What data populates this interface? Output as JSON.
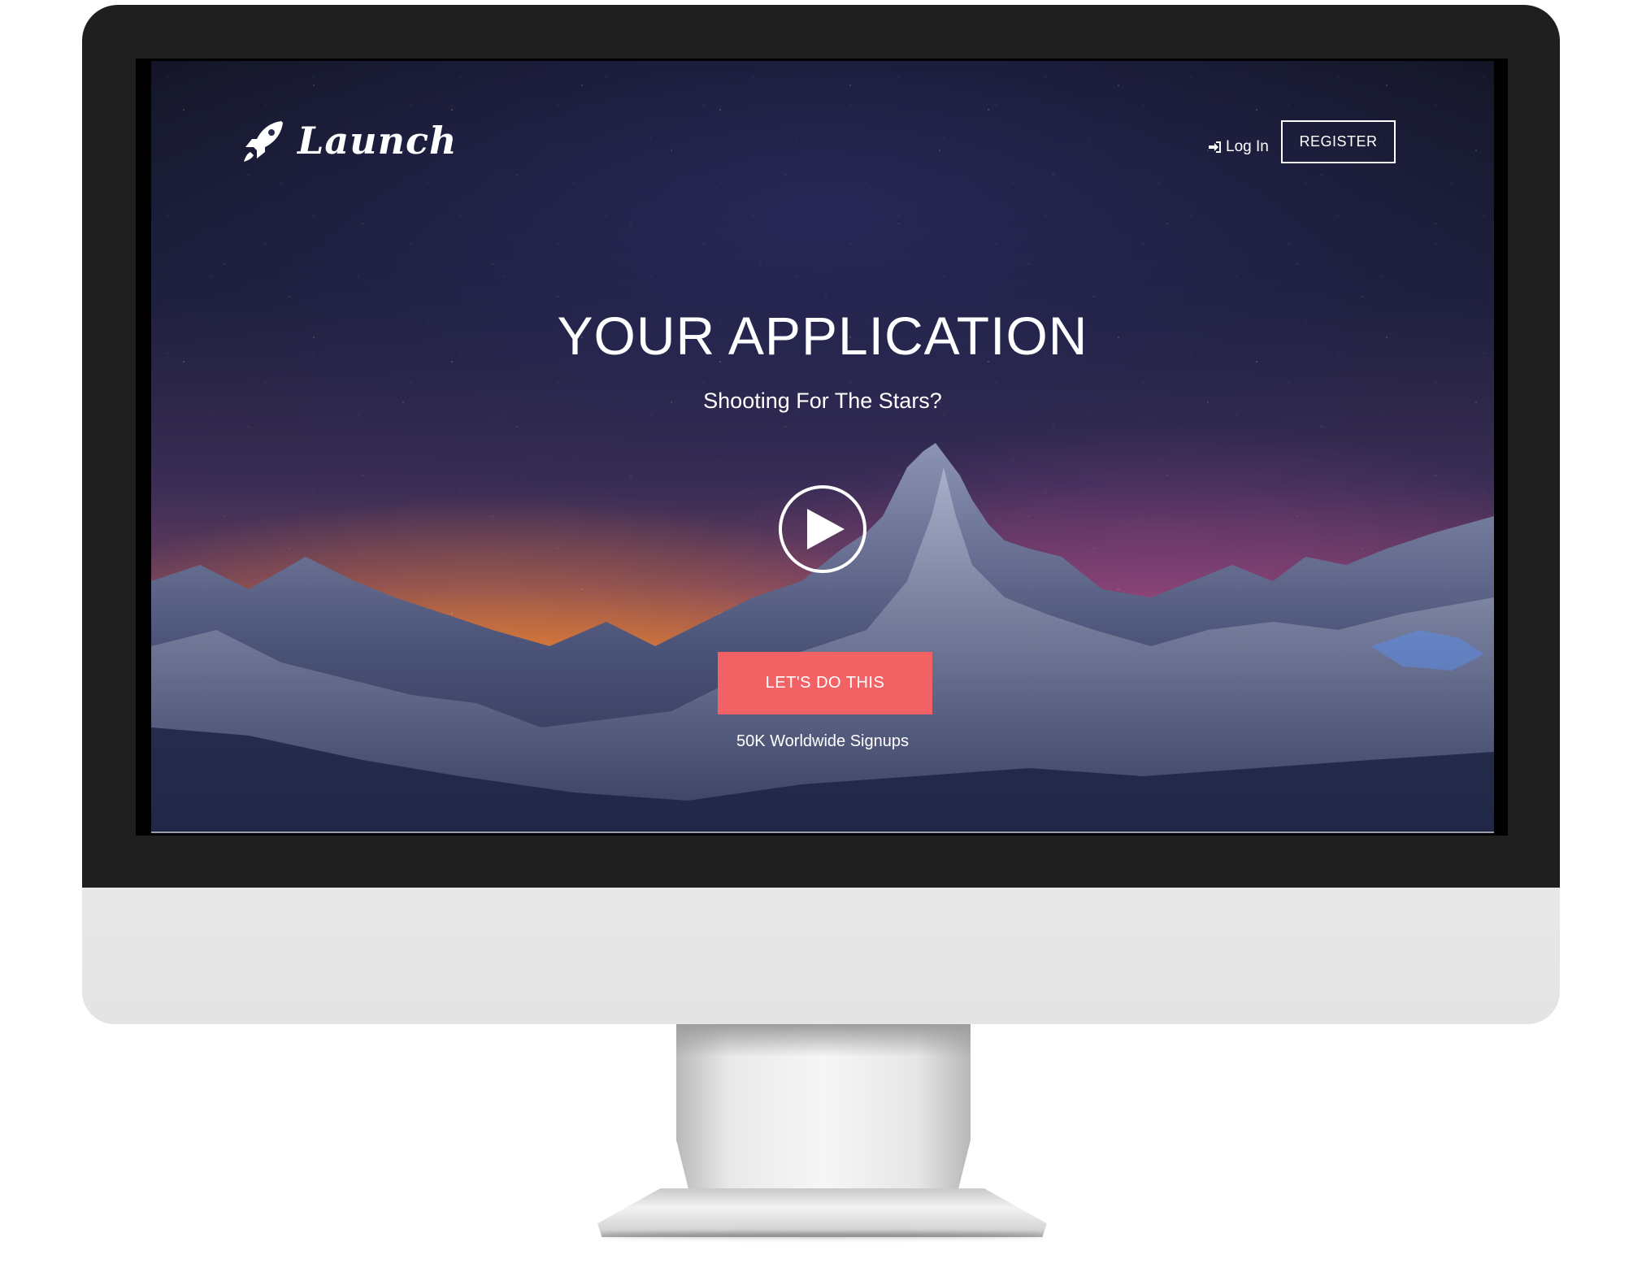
{
  "brand": {
    "name": "Launch",
    "logo_icon": "rocket-icon"
  },
  "nav": {
    "login_icon": "sign-in-icon",
    "login_label": "Log In",
    "register_label": "REGISTER"
  },
  "hero": {
    "title": "YOUR APPLICATION",
    "subtitle": "Shooting For The Stars?",
    "play_icon": "play-icon",
    "cta_label": "LET'S DO THIS",
    "signups_text": "50K Worldwide Signups"
  },
  "colors": {
    "cta": "#f26265",
    "bezel": "#1f1f1f",
    "chin": "#e5e6e5",
    "text": "#ffffff"
  }
}
